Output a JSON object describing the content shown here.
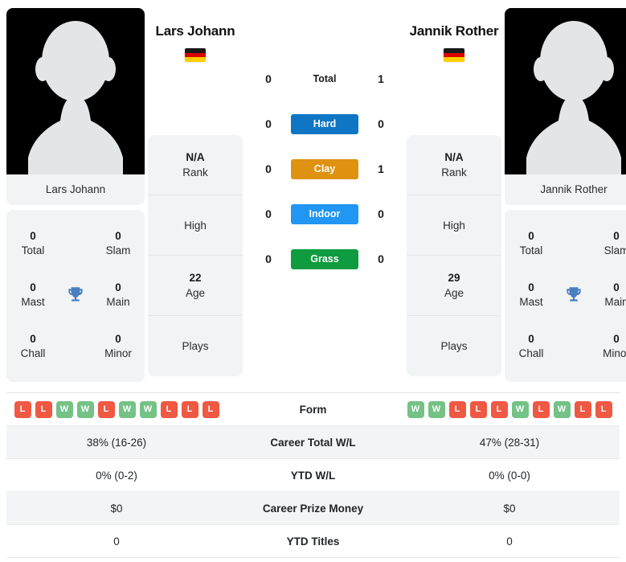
{
  "players": {
    "left": {
      "name": "Lars Johann",
      "photo_caption": "Lars Johann",
      "country_flag": "germany-flag",
      "flag_colors": [
        "#1a1a1a",
        "#dd0000",
        "#ffce00"
      ],
      "rank": "N/A",
      "rank_label": "Rank",
      "high_value": "",
      "high_label": "High",
      "age": "22",
      "age_label": "Age",
      "plays_value": "",
      "plays_label": "Plays",
      "titles": {
        "total": "0",
        "total_label": "Total",
        "slam": "0",
        "slam_label": "Slam",
        "mast": "0",
        "mast_label": "Mast",
        "main": "0",
        "main_label": "Main",
        "chall": "0",
        "chall_label": "Chall",
        "minor": "0",
        "minor_label": "Minor"
      },
      "form": [
        "L",
        "L",
        "W",
        "W",
        "L",
        "W",
        "W",
        "L",
        "L",
        "L"
      ],
      "career_total_wl": "38% (16-26)",
      "ytd_wl": "0% (0-2)",
      "career_prize_money": "$0",
      "ytd_titles": "0"
    },
    "right": {
      "name": "Jannik Rother",
      "photo_caption": "Jannik Rother",
      "country_flag": "germany-flag",
      "flag_colors": [
        "#1a1a1a",
        "#dd0000",
        "#ffce00"
      ],
      "rank": "N/A",
      "rank_label": "Rank",
      "high_value": "",
      "high_label": "High",
      "age": "29",
      "age_label": "Age",
      "plays_value": "",
      "plays_label": "Plays",
      "titles": {
        "total": "0",
        "total_label": "Total",
        "slam": "0",
        "slam_label": "Slam",
        "mast": "0",
        "mast_label": "Mast",
        "main": "0",
        "main_label": "Main",
        "chall": "0",
        "chall_label": "Chall",
        "minor": "0",
        "minor_label": "Minor"
      },
      "form": [
        "W",
        "W",
        "L",
        "L",
        "L",
        "W",
        "L",
        "W",
        "L",
        "L"
      ],
      "career_total_wl": "47% (28-31)",
      "ytd_wl": "0% (0-0)",
      "career_prize_money": "$0",
      "ytd_titles": "0"
    }
  },
  "head_to_head": {
    "rows": [
      {
        "label": "Total",
        "left": "0",
        "right": "1",
        "badge": false,
        "color": ""
      },
      {
        "label": "Hard",
        "left": "0",
        "right": "0",
        "badge": true,
        "color": "#0f76c5"
      },
      {
        "label": "Clay",
        "left": "0",
        "right": "1",
        "badge": true,
        "color": "#de9210"
      },
      {
        "label": "Indoor",
        "left": "0",
        "right": "0",
        "badge": true,
        "color": "#2196f3"
      },
      {
        "label": "Grass",
        "left": "0",
        "right": "0",
        "badge": true,
        "color": "#0f9b3f"
      }
    ]
  },
  "stats_table": {
    "rows": [
      {
        "label": "Form",
        "type": "form",
        "left": "",
        "right": ""
      },
      {
        "label": "Career Total W/L",
        "type": "text",
        "left": "38% (16-26)",
        "right": "47% (28-31)"
      },
      {
        "label": "YTD W/L",
        "type": "text",
        "left": "0% (0-2)",
        "right": "0% (0-0)"
      },
      {
        "label": "Career Prize Money",
        "type": "text",
        "left": "$0",
        "right": "$0"
      },
      {
        "label": "YTD Titles",
        "type": "text",
        "left": "0",
        "right": "0"
      }
    ]
  },
  "icons": {
    "trophy": "trophy-icon",
    "avatar": "avatar-placeholder-icon"
  },
  "colors": {
    "win": "#74c285",
    "loss": "#ef5843",
    "card_bg": "#f1f3f4",
    "row_shade": "#f3f4f5"
  }
}
